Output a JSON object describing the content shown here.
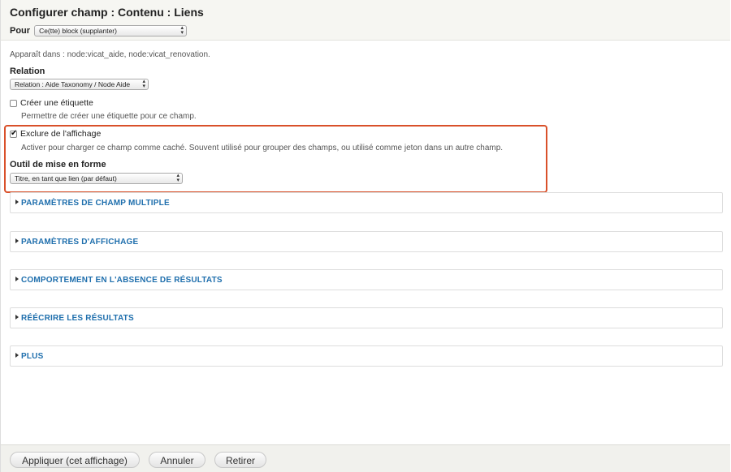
{
  "header": {
    "title": "Configurer champ : Contenu : Liens",
    "for_label": "Pour",
    "for_select_value": "Ce(tte) block (supplanter)"
  },
  "main": {
    "appears_in": "Apparaît dans : node:vicat_aide, node:vicat_renovation.",
    "relation": {
      "label": "Relation",
      "select_value": "Relation : Aide Taxonomy / Node Aide"
    },
    "create_label": {
      "checkbox_label": "Créer une étiquette",
      "checked": false,
      "description": "Permettre de créer une étiquette pour ce champ."
    },
    "exclude": {
      "checkbox_label": "Exclure de l'affichage",
      "checked": true,
      "description": "Activer pour charger ce champ comme caché. Souvent utilisé pour grouper des champs, ou utilisé comme jeton dans un autre champ."
    },
    "formatter": {
      "label": "Outil de mise en forme",
      "select_value": "Titre, en tant que lien (par défaut)"
    },
    "highlight_color": "#d9502a",
    "fieldsets": [
      {
        "label": "PARAMÈTRES DE CHAMP MULTIPLE"
      },
      {
        "label": "PARAMÈTRES D'AFFICHAGE"
      },
      {
        "label": "COMPORTEMENT EN L'ABSENCE DE RÉSULTATS"
      },
      {
        "label": "RÉÉCRIRE LES RÉSULTATS"
      },
      {
        "label": "PLUS"
      }
    ],
    "link_color": "#1f6fad"
  },
  "footer": {
    "apply_label": "Appliquer (cet affichage)",
    "cancel_label": "Annuler",
    "remove_label": "Retirer"
  }
}
